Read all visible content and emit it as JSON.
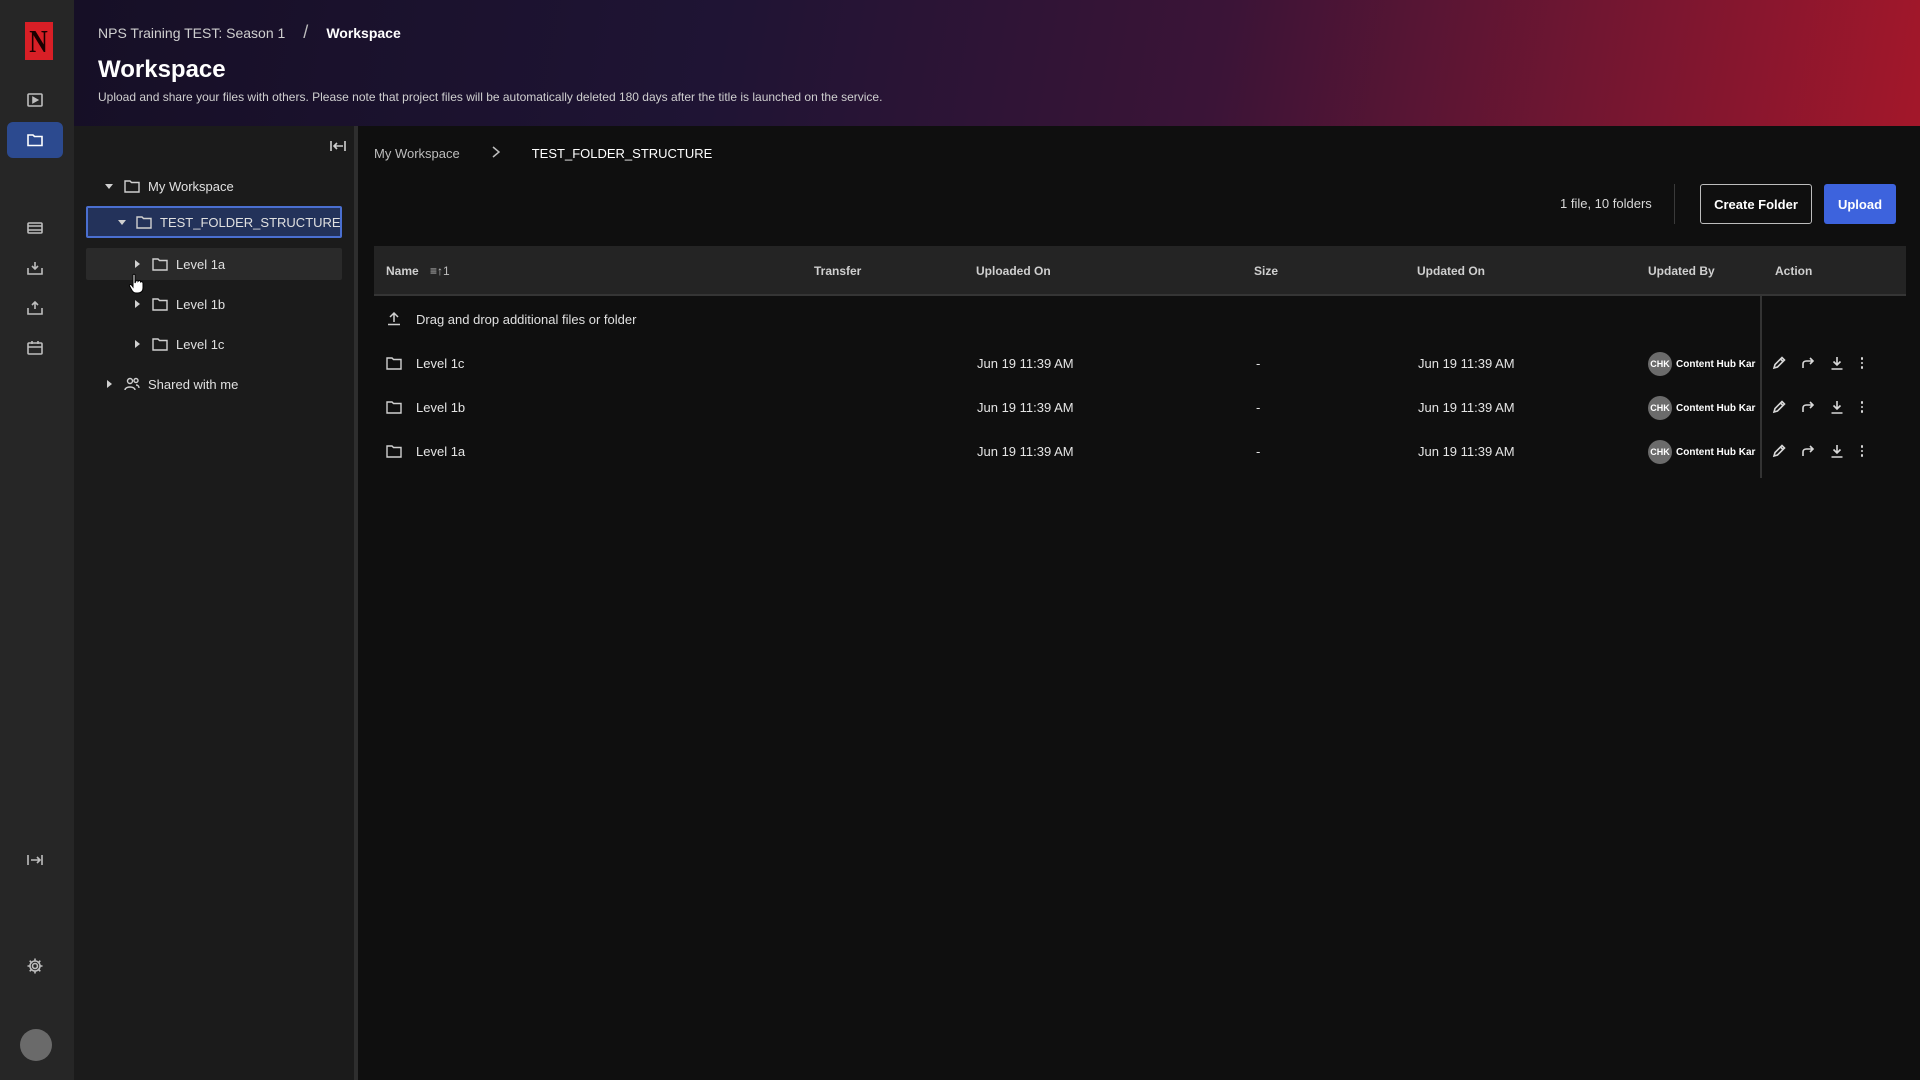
{
  "colors": {
    "accent": "#3d63dd",
    "selected": "#23325a",
    "brand": "#d81f26"
  },
  "rail": {
    "logo_letter": "N",
    "icons": [
      "play-icon",
      "folder-icon",
      "film-icon",
      "inbox-icon",
      "delivery-icon",
      "calendar-icon",
      "expand-icon",
      "gear-icon"
    ]
  },
  "header": {
    "breadcrumb_parent": "NPS Training TEST: Season 1",
    "breadcrumb_sep": "/",
    "breadcrumb_current": "Workspace",
    "title": "Workspace",
    "subtitle": "Upload and share your files with others. Please note that project files will be automatically deleted 180 days after the title is launched on the service."
  },
  "tree": {
    "root": "My Workspace",
    "selected": "TEST_FOLDER_STRUCTURE",
    "children": [
      "Level 1a",
      "Level 1b",
      "Level 1c"
    ],
    "shared": "Shared with me"
  },
  "main": {
    "breadcrumb_root": "My Workspace",
    "breadcrumb_current": "TEST_FOLDER_STRUCTURE",
    "count": "1 file, 10 folders",
    "create_folder": "Create Folder",
    "upload": "Upload",
    "drop_text": "Drag and drop additional files or folder"
  },
  "table": {
    "columns": {
      "name": "Name",
      "sort": "≡↑1",
      "transfer": "Transfer",
      "uploaded_on": "Uploaded On",
      "size": "Size",
      "updated_on": "Updated On",
      "updated_by": "Updated By",
      "action": "Action"
    },
    "rows": [
      {
        "name": "Level 1c",
        "uploaded_on": "Jun 19 11:39 AM",
        "size": "-",
        "updated_on": "Jun 19 11:39 AM",
        "initials": "CHK",
        "updated_by": "Content Hub Kar"
      },
      {
        "name": "Level 1b",
        "uploaded_on": "Jun 19 11:39 AM",
        "size": "-",
        "updated_on": "Jun 19 11:39 AM",
        "initials": "CHK",
        "updated_by": "Content Hub Kar"
      },
      {
        "name": "Level 1a",
        "uploaded_on": "Jun 19 11:39 AM",
        "size": "-",
        "updated_on": "Jun 19 11:39 AM",
        "initials": "CHK",
        "updated_by": "Content Hub Kar"
      }
    ]
  }
}
